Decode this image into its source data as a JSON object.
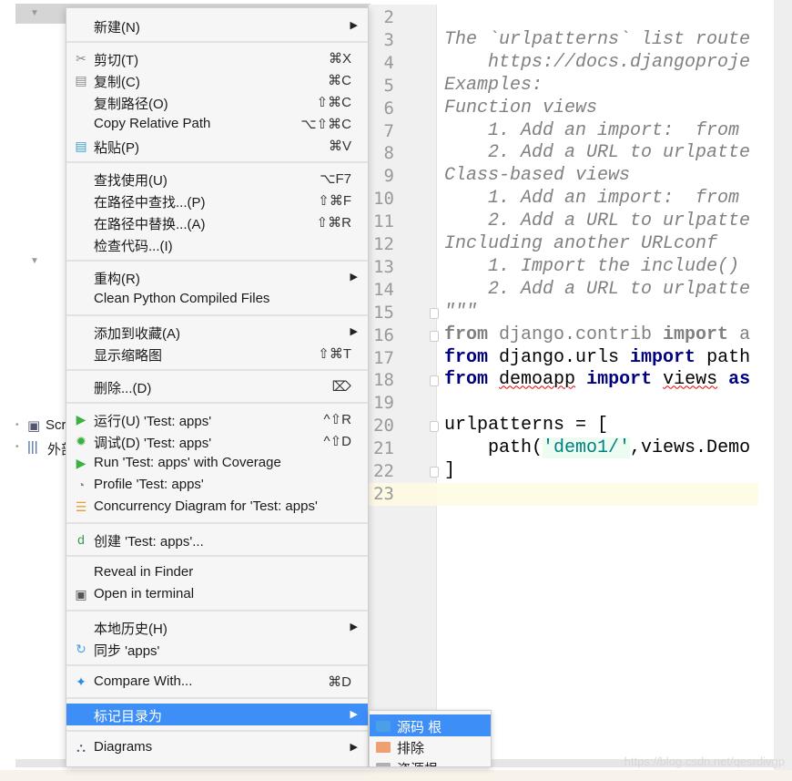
{
  "tree": {
    "scratches_label": "Scr",
    "external_label": "外部"
  },
  "gutter": {
    "lines": [
      "2",
      "3",
      "4",
      "5",
      "6",
      "7",
      "8",
      "9",
      "10",
      "11",
      "12",
      "13",
      "14",
      "15",
      "16",
      "17",
      "18",
      "19",
      "20",
      "21",
      "22",
      "23"
    ]
  },
  "code": {
    "lines": [
      [],
      [
        {
          "t": "The `urlpatterns` list route",
          "c": "cm"
        }
      ],
      [
        {
          "t": "    https://docs.djangoproje",
          "c": "cm"
        }
      ],
      [
        {
          "t": "Examples:",
          "c": "cm"
        }
      ],
      [
        {
          "t": "Function views",
          "c": "cm"
        }
      ],
      [
        {
          "t": "    1. Add an import:  from",
          "c": "cm"
        }
      ],
      [
        {
          "t": "    2. Add a URL to urlpatte",
          "c": "cm"
        }
      ],
      [
        {
          "t": "Class-based views",
          "c": "cm"
        }
      ],
      [
        {
          "t": "    1. Add an import:  from",
          "c": "cm"
        }
      ],
      [
        {
          "t": "    2. Add a URL to urlpatte",
          "c": "cm"
        }
      ],
      [
        {
          "t": "Including another URLconf",
          "c": "cm"
        }
      ],
      [
        {
          "t": "    1. Import the include()",
          "c": "cm"
        }
      ],
      [
        {
          "t": "    2. Add a URL to urlpatte",
          "c": "cm"
        }
      ],
      [
        {
          "t": "\"\"\"",
          "c": "cm"
        }
      ],
      [
        {
          "t": "from",
          "c": "dimkw"
        },
        {
          "t": " django.contrib ",
          "c": "dim"
        },
        {
          "t": "import",
          "c": "dimkw"
        },
        {
          "t": " a",
          "c": "dim"
        }
      ],
      [
        {
          "t": "from",
          "c": "kw"
        },
        {
          "t": " django.urls ",
          "c": ""
        },
        {
          "t": "import",
          "c": "kw"
        },
        {
          "t": " path",
          "c": ""
        }
      ],
      [
        {
          "t": "from",
          "c": "kw"
        },
        {
          "t": " ",
          "c": ""
        },
        {
          "t": "demoapp",
          "c": "err"
        },
        {
          "t": " ",
          "c": ""
        },
        {
          "t": "import",
          "c": "kw"
        },
        {
          "t": " ",
          "c": ""
        },
        {
          "t": "views",
          "c": "err"
        },
        {
          "t": " ",
          "c": ""
        },
        {
          "t": "as",
          "c": "kw"
        }
      ],
      [],
      [
        {
          "t": "urlpatterns = [",
          "c": ""
        }
      ],
      [
        {
          "t": "    path(",
          "c": ""
        },
        {
          "t": "'demo1/'",
          "c": "str"
        },
        {
          "t": ",views.Demo",
          "c": ""
        }
      ],
      [
        {
          "t": "]",
          "c": ""
        }
      ],
      []
    ]
  },
  "menu": {
    "items": [
      {
        "label": "新建(N)",
        "submenu": true
      },
      {
        "sep": true
      },
      {
        "label": "剪切(T)",
        "shortcut": "⌘X",
        "icon": "scissors-icon",
        "glyph": "✂"
      },
      {
        "label": "复制(C)",
        "shortcut": "⌘C",
        "icon": "copy-icon",
        "glyph": "▤"
      },
      {
        "label": "复制路径(O)",
        "shortcut": "⇧⌘C"
      },
      {
        "label": "Copy Relative Path",
        "shortcut": "⌥⇧⌘C"
      },
      {
        "label": "粘贴(P)",
        "shortcut": "⌘V",
        "icon": "paste-icon",
        "glyph": "▤"
      },
      {
        "sep": true
      },
      {
        "label": "查找使用(U)",
        "shortcut": "⌥F7"
      },
      {
        "label": "在路径中查找...(P)",
        "shortcut": "⇧⌘F"
      },
      {
        "label": "在路径中替换...(A)",
        "shortcut": "⇧⌘R"
      },
      {
        "label": "检查代码...(I)"
      },
      {
        "sep": true
      },
      {
        "label": "重构(R)",
        "submenu": true
      },
      {
        "label": "Clean Python Compiled Files"
      },
      {
        "sep": true
      },
      {
        "label": "添加到收藏(A)",
        "submenu": true
      },
      {
        "label": "显示缩略图",
        "shortcut": "⇧⌘T"
      },
      {
        "sep": true
      },
      {
        "label": "删除...(D)",
        "shortcut": "⌦"
      },
      {
        "sep": true
      },
      {
        "label": "运行(U) 'Test: apps'",
        "shortcut": "^⇧R",
        "icon": "run-icon",
        "glyph": "▶"
      },
      {
        "label": "调试(D) 'Test: apps'",
        "shortcut": "^⇧D",
        "icon": "debug-bug-icon",
        "glyph": "✹"
      },
      {
        "label": "Run 'Test: apps' with Coverage",
        "icon": "coverage-icon",
        "glyph": "▶"
      },
      {
        "label": "Profile 'Test: apps'",
        "icon": "profile-icon",
        "glyph": "◔"
      },
      {
        "label": "Concurrency Diagram for 'Test: apps'",
        "icon": "concurrency-icon",
        "glyph": "☰"
      },
      {
        "sep": true
      },
      {
        "label": "创建 'Test: apps'...",
        "icon": "create-config-icon",
        "glyph": "d"
      },
      {
        "sep": true
      },
      {
        "label": "Reveal in Finder"
      },
      {
        "label": "Open in terminal",
        "icon": "terminal-icon",
        "glyph": "▣"
      },
      {
        "sep": true
      },
      {
        "label": "本地历史(H)",
        "submenu": true
      },
      {
        "label": "同步 'apps'",
        "icon": "sync-icon",
        "glyph": "↻"
      },
      {
        "sep": true
      },
      {
        "label": "Compare With...",
        "shortcut": "⌘D",
        "icon": "compare-icon",
        "glyph": "✦"
      },
      {
        "sep": true
      },
      {
        "label": "标记目录为",
        "submenu": true,
        "highlighted": true
      },
      {
        "sep": true
      },
      {
        "label": "Diagrams",
        "submenu": true,
        "icon": "diagram-icon",
        "glyph": "⛬"
      }
    ]
  },
  "submenu": {
    "items": [
      {
        "label": "源码 根",
        "color": "#4a9fe6",
        "highlighted": true
      },
      {
        "label": "排除",
        "color": "#f0a070"
      },
      {
        "label": "资源根",
        "color": "#b0b0b0"
      }
    ]
  },
  "watermark": "https://blog.csdn.net/qesrdivgp",
  "colors": {
    "highlight": "#3d8ef7",
    "keyword": "#000080",
    "comment": "#808080",
    "string": "#008080"
  }
}
